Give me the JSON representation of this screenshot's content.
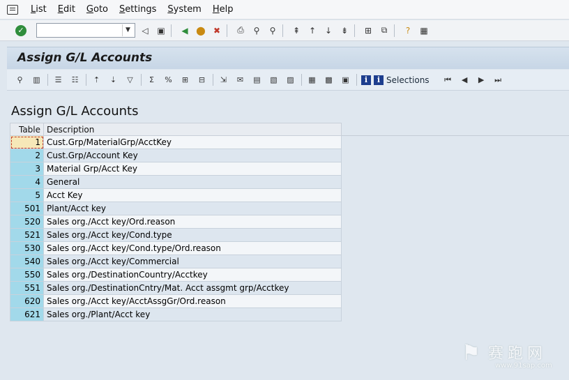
{
  "menu": {
    "items": [
      {
        "name": "menu-list",
        "label": "List"
      },
      {
        "name": "menu-edit",
        "label": "Edit"
      },
      {
        "name": "menu-goto",
        "label": "Goto"
      },
      {
        "name": "menu-settings",
        "label": "Settings"
      },
      {
        "name": "menu-system",
        "label": "System"
      },
      {
        "name": "menu-help",
        "label": "Help"
      }
    ]
  },
  "command_field": {
    "value": ""
  },
  "title": "Assign G/L Accounts",
  "appbar": {
    "selections_label": "Selections"
  },
  "list": {
    "title": "Assign G/L Accounts",
    "columns": [
      "Table",
      "Description"
    ],
    "rows": [
      {
        "table": "1",
        "description": "Cust.Grp/MaterialGrp/AcctKey"
      },
      {
        "table": "2",
        "description": "Cust.Grp/Account Key"
      },
      {
        "table": "3",
        "description": "Material Grp/Acct Key"
      },
      {
        "table": "4",
        "description": "General"
      },
      {
        "table": "5",
        "description": "Acct Key"
      },
      {
        "table": "501",
        "description": "Plant/Acct key"
      },
      {
        "table": "520",
        "description": "Sales org./Acct key/Ord.reason"
      },
      {
        "table": "521",
        "description": "Sales org./Acct key/Cond.type"
      },
      {
        "table": "530",
        "description": "Sales org./Acct key/Cond.type/Ord.reason"
      },
      {
        "table": "540",
        "description": "Sales org./Acct key/Commercial"
      },
      {
        "table": "550",
        "description": "Sales org./DestinationCountry/Acctkey"
      },
      {
        "table": "551",
        "description": "Sales org./DestinationCntry/Mat. Acct assgmt grp/Acctkey"
      },
      {
        "table": "620",
        "description": "Sales org./Acct key/AcctAssgGr/Ord.reason"
      },
      {
        "table": "621",
        "description": "Sales org./Plant/Acct key"
      }
    ]
  },
  "watermark": {
    "cn": "赛跑网",
    "url": "www.91sap.com"
  }
}
